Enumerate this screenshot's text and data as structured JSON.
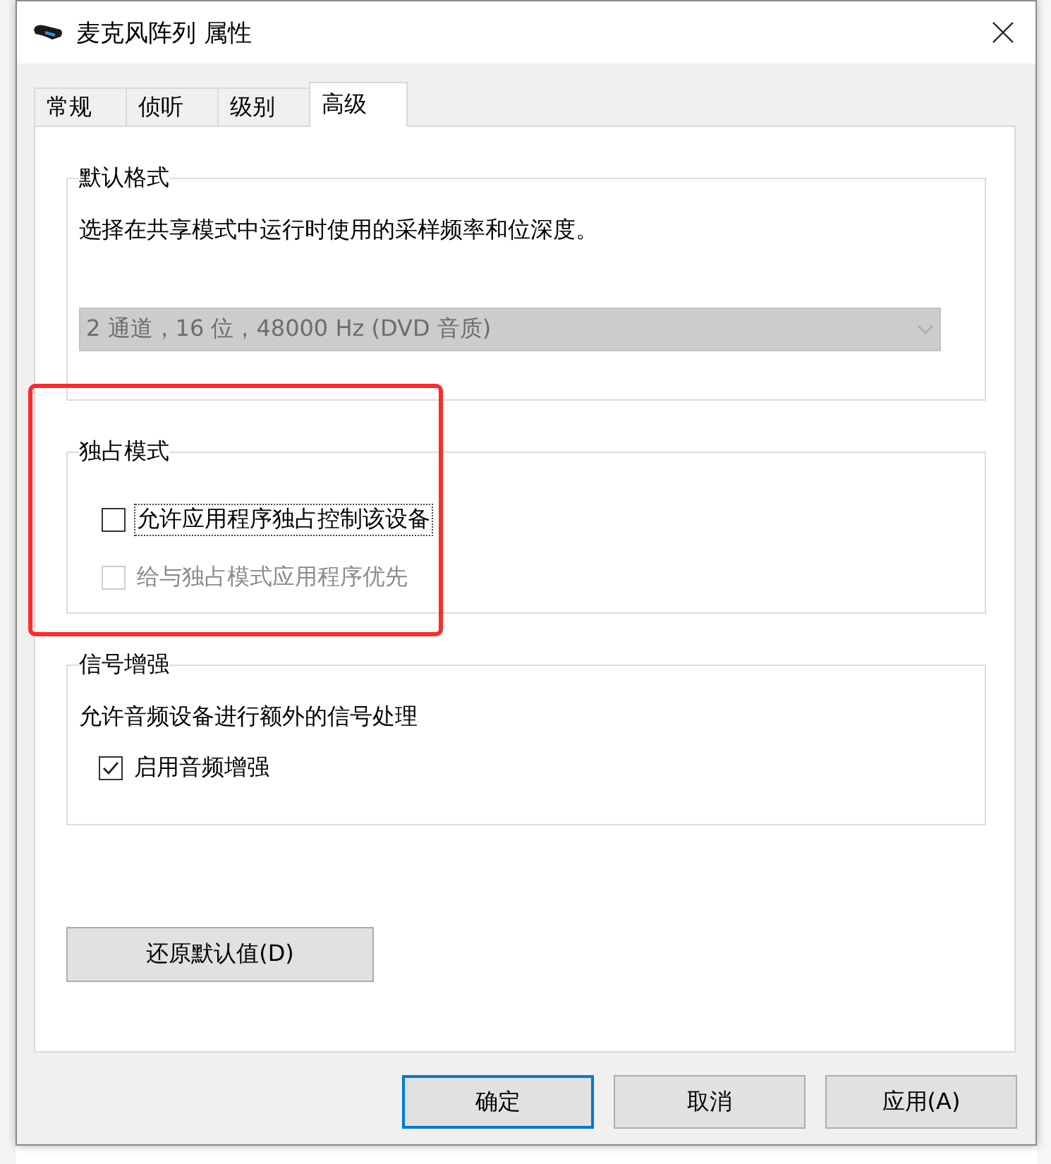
{
  "window": {
    "title": "麦克风阵列 属性"
  },
  "tabs": [
    {
      "label": "常规",
      "selected": false
    },
    {
      "label": "侦听",
      "selected": false
    },
    {
      "label": "级别",
      "selected": false
    },
    {
      "label": "高级",
      "selected": true
    }
  ],
  "default_format": {
    "title": "默认格式",
    "description": "选择在共享模式中运行时使用的采样频率和位深度。",
    "dropdown": {
      "value": "2 通道，16 位，48000 Hz (DVD 音质)",
      "disabled": true
    }
  },
  "exclusive_mode": {
    "title": "独占模式",
    "options": [
      {
        "label": "允许应用程序独占控制该设备",
        "checked": false,
        "disabled": false,
        "focused": true
      },
      {
        "label": "给与独占模式应用程序优先",
        "checked": false,
        "disabled": true,
        "focused": false
      }
    ]
  },
  "signal_enhancement": {
    "title": "信号增强",
    "description": "允许音频设备进行额外的信号处理",
    "options": [
      {
        "label": "启用音频增强",
        "checked": true,
        "disabled": false,
        "focused": false
      }
    ]
  },
  "restore_button": {
    "label": "还原默认值(D)"
  },
  "buttons": [
    {
      "label": "确定",
      "default": true
    },
    {
      "label": "取消",
      "default": false
    },
    {
      "label": "应用(A)",
      "default": false
    }
  ]
}
